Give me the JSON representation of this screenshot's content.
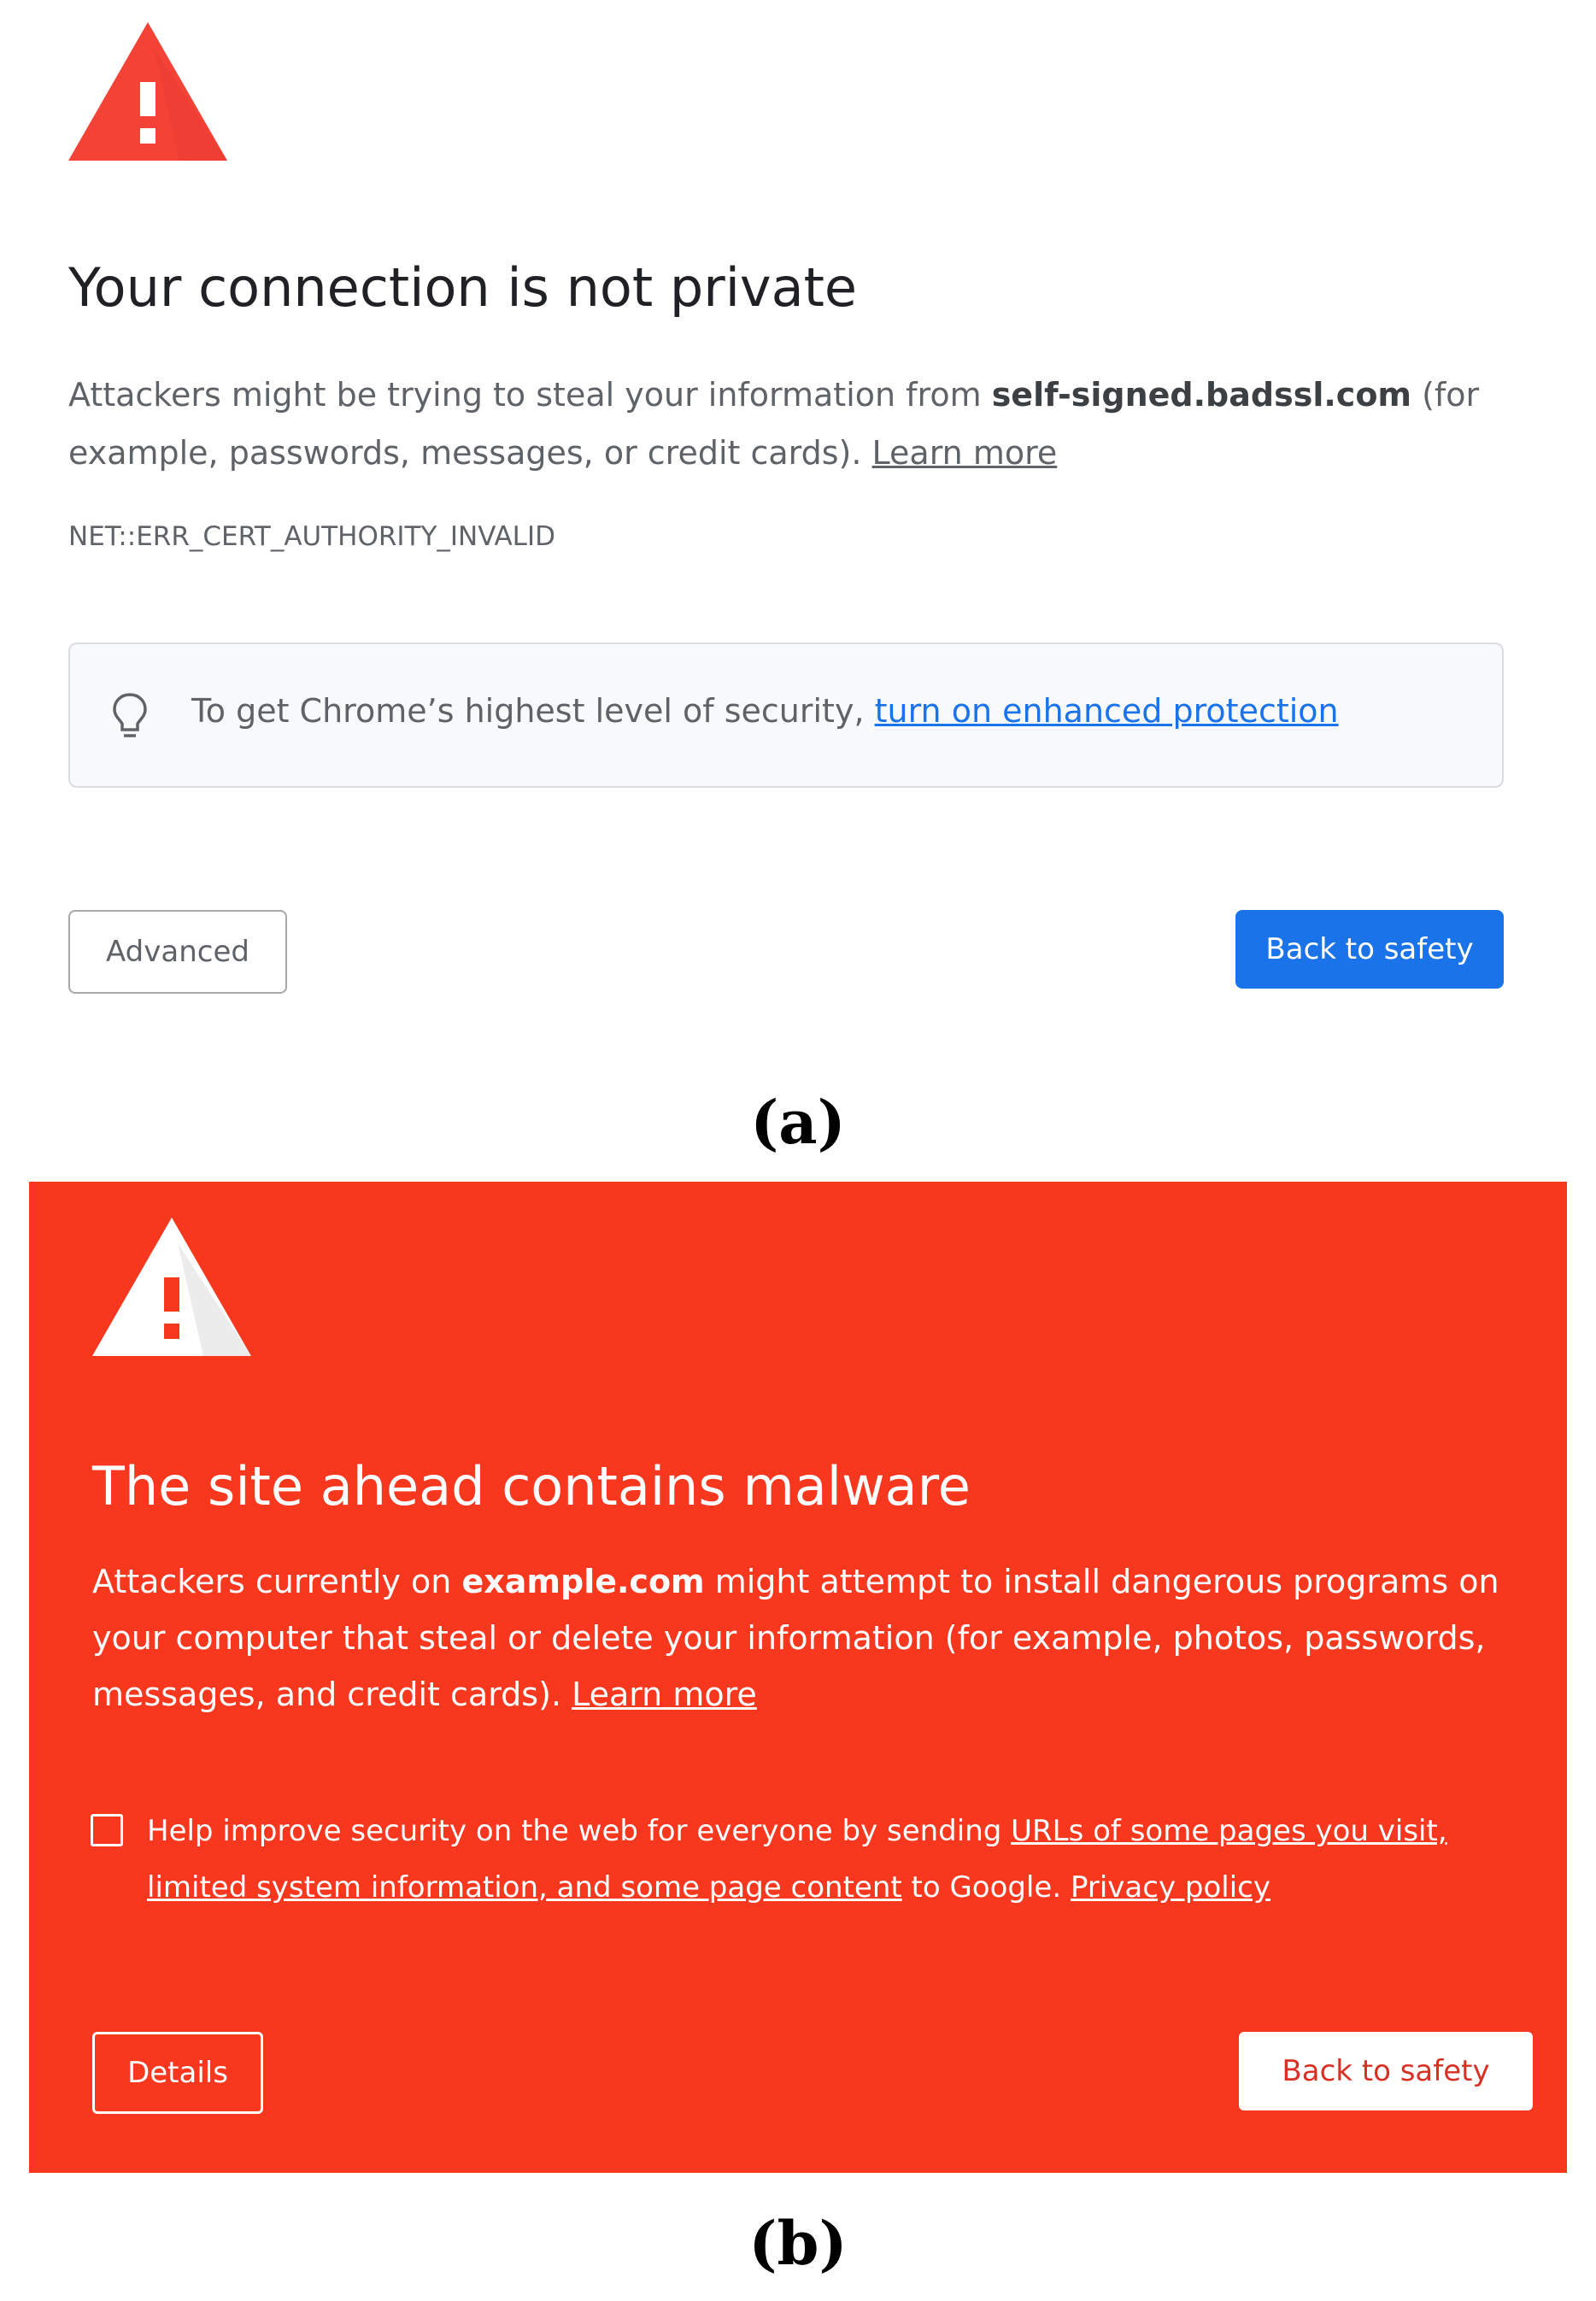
{
  "panel_a": {
    "title": "Your connection is not private",
    "body_prefix": "Attackers might be trying to steal your information from ",
    "body_domain": "self-signed.badssl.com",
    "body_suffix": " (for example, passwords, messages, or credit cards). ",
    "learn_more": "Learn more",
    "error_code": "NET::ERR_CERT_AUTHORITY_INVALID",
    "enhanced_prefix": "To get Chrome’s highest level of security, ",
    "enhanced_link": "turn on enhanced protection",
    "advanced_button": "Advanced",
    "back_button": "Back to safety",
    "icon_color": "#f44336",
    "accent": "#1a73e8",
    "caption": "(a)"
  },
  "panel_b": {
    "title": "The site ahead contains malware",
    "body_prefix": "Attackers currently on ",
    "body_domain": "example.com",
    "body_suffix": " might attempt to install dangerous programs on your computer that steal or delete your information (for example, photos, passwords, messages, and credit cards). ",
    "learn_more": "Learn more",
    "report_prefix": "Help improve security on the web for everyone by sending ",
    "report_link": "URLs of some pages you visit, limited system information, and some page content",
    "report_middle": " to Google. ",
    "privacy_link": "Privacy policy",
    "checkbox_checked": false,
    "details_button": "Details",
    "back_button": "Back to safety",
    "background_color": "#f8371f",
    "caption": "(b)"
  }
}
